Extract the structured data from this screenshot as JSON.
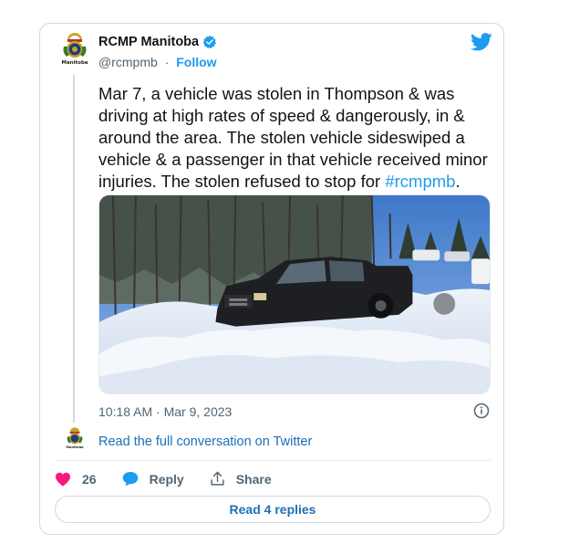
{
  "author": {
    "name": "RCMP Manitoba",
    "handle": "@rcmpmb",
    "separator": "·",
    "follow_label": "Follow"
  },
  "avatar_text": "Manitoba",
  "tweet": {
    "text_before_hashtag": "Mar 7, a vehicle was stolen in Thompson & was driving at high rates of speed & dangerously, in & around the area. The stolen vehicle sideswiped a vehicle & a passenger in that vehicle received minor injuries. The stolen refused to stop for ",
    "hashtag": "#rcmpmb",
    "text_after_hashtag": "."
  },
  "timestamp": "10:18 AM · Mar 9, 2023",
  "read_full_label": "Read the full conversation on Twitter",
  "actions": {
    "likes_count": "26",
    "reply_label": "Reply",
    "share_label": "Share"
  },
  "read_replies_label": "Read 4 replies",
  "colors": {
    "accent": "#1d9bf0",
    "link": "#1d6fb8",
    "like": "#f91880",
    "muted": "#536471"
  },
  "icons": [
    "rcmp-crest-icon",
    "verified-badge-icon",
    "twitter-bird-icon",
    "info-icon",
    "heart-icon",
    "reply-bubble-icon",
    "share-icon"
  ]
}
